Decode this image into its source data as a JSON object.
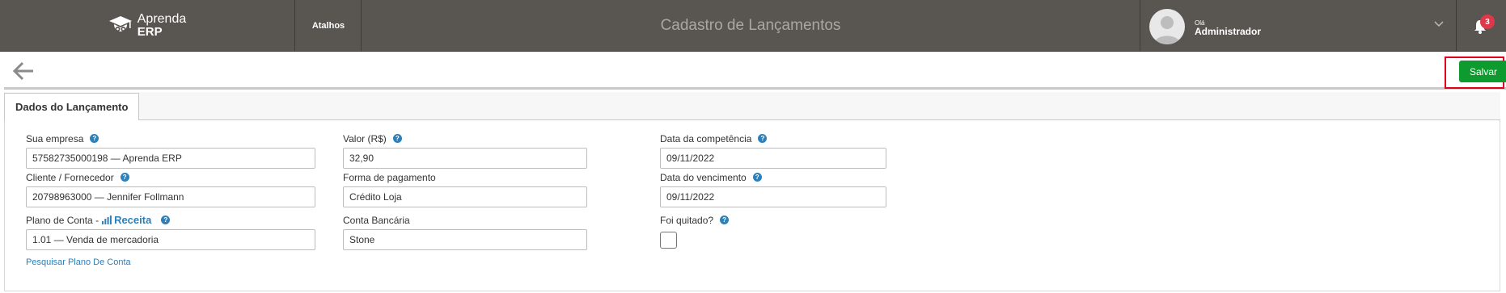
{
  "header": {
    "logo_line1": "Aprenda",
    "logo_line2": "ERP",
    "shortcuts_label": "Atalhos",
    "page_title": "Cadastro de Lançamentos",
    "greeting": "Olá",
    "user_name": "Administrador",
    "notification_count": "3"
  },
  "toolbar": {
    "save_label": "Salvar"
  },
  "tabs": [
    {
      "label": "Dados do Lançamento",
      "active": true
    }
  ],
  "form": {
    "empresa": {
      "label": "Sua empresa",
      "value": "57582735000198 — Aprenda ERP"
    },
    "cliente": {
      "label": "Cliente / Fornecedor",
      "value": "20798963000 — Jennifer Follmann"
    },
    "plano": {
      "label": "Plano de Conta -",
      "type_label": "Receita",
      "value": "1.01 — Venda de mercadoria",
      "search_link": "Pesquisar Plano De Conta"
    },
    "valor": {
      "label": "Valor (R$)",
      "value": "32,90"
    },
    "forma_pagamento": {
      "label": "Forma de pagamento",
      "value": "Crédito Loja"
    },
    "conta_bancaria": {
      "label": "Conta Bancária",
      "value": "Stone"
    },
    "data_competencia": {
      "label": "Data da competência",
      "value": "09/11/2022"
    },
    "data_vencimento": {
      "label": "Data do vencimento",
      "value": "09/11/2022"
    },
    "foi_quitado": {
      "label": "Foi quitado?",
      "checked": false
    }
  },
  "colors": {
    "header_bg": "#595651",
    "accent_blue": "#2f7fb8",
    "save_green": "#0d9a2e",
    "badge_red": "#e0384b",
    "highlight_red": "#e0001b"
  },
  "icons": [
    "graduation-owl-logo-icon",
    "user-avatar-icon",
    "chevron-down-icon",
    "bell-icon",
    "back-arrow-icon",
    "help-icon",
    "bar-chart-icon"
  ]
}
